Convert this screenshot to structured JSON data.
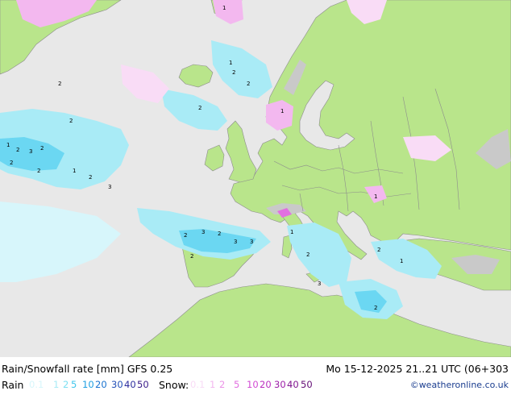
{
  "title": "Rain/Snowfall rate [mm] GFS 0.25",
  "timestamp": "Mo 15-12-2025 21..21 UTC (06+303",
  "legend": {
    "rain_label": "Rain",
    "rain_values": [
      {
        "text": "0.1",
        "color": "#d7f6fb"
      },
      {
        "text": "1",
        "color": "#a9ebf6"
      },
      {
        "text": "2",
        "color": "#7ee0f2"
      },
      {
        "text": "5",
        "color": "#3fc6ec"
      },
      {
        "text": "10",
        "color": "#1e9fe2"
      },
      {
        "text": "20",
        "color": "#1a73d0"
      },
      {
        "text": "30",
        "color": "#2350b8"
      },
      {
        "text": "40",
        "color": "#2d2d9e"
      },
      {
        "text": "50",
        "color": "#3a1c8a"
      }
    ],
    "snow_label": "Snow:",
    "snow_values": [
      {
        "text": "0.1",
        "color": "#f9dcf6"
      },
      {
        "text": "1",
        "color": "#f3b8ef"
      },
      {
        "text": "2",
        "color": "#ec94e8"
      },
      {
        "text": "5",
        "color": "#e26fe0"
      },
      {
        "text": "10",
        "color": "#d24bd3"
      },
      {
        "text": "20",
        "color": "#bb2fc0"
      },
      {
        "text": "30",
        "color": "#9d1ea8"
      },
      {
        "text": "40",
        "color": "#80158f"
      },
      {
        "text": "50",
        "color": "#640e76"
      }
    ]
  },
  "credit": "©weatheronline.co.uk",
  "colors": {
    "sea": "#e8e8e8",
    "land": "#b9e58b",
    "highland": "#c9c9c9",
    "border": "#8c8c8c",
    "rain_light": "#a9ebf6",
    "rain_mid": "#6bd7f2",
    "snow_light": "#f3b8ef"
  }
}
